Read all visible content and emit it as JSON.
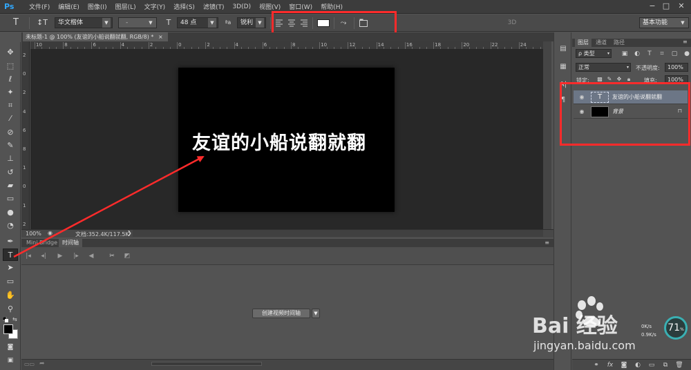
{
  "menubar": {
    "logo": "Ps",
    "items": [
      "文件(F)",
      "编辑(E)",
      "图像(I)",
      "图层(L)",
      "文字(Y)",
      "选择(S)",
      "滤镜(T)",
      "3D(D)",
      "视图(V)",
      "窗口(W)",
      "帮助(H)"
    ],
    "minimize": "−",
    "restore": "□",
    "close": "✕"
  },
  "options": {
    "tool_icon": "T",
    "orient_icon": "↕T",
    "font_family": "华文楷体",
    "font_style": "-",
    "size_icon": "T",
    "font_size": "48 点",
    "aa_icon": "ªa",
    "antialias": "锐利",
    "text_color": "#ffffff",
    "workspace": "基本功能",
    "threed_label": "3D"
  },
  "document": {
    "tab_title": "未标题-1 @ 100% (友谊的小船说翻就翻, RGB/8) *",
    "text": "友谊的小船说翻就翻",
    "canvas_color": "#000000"
  },
  "ruler": {
    "h": [
      "10",
      "8",
      "6",
      "4",
      "2",
      "0",
      "2",
      "4",
      "6",
      "8",
      "10",
      "12",
      "14",
      "16",
      "18",
      "20",
      "22",
      "24"
    ],
    "v": [
      "2",
      "0",
      "2",
      "4",
      "6",
      "8",
      "1",
      "0",
      "1",
      "2"
    ]
  },
  "status": {
    "zoom": "100%",
    "doc_size": "文档:352.4K/117.5K"
  },
  "timeline": {
    "tabs": [
      "Mini Bridge",
      "时间轴"
    ],
    "active_tab": 1,
    "create_button": "创建视频时间轴"
  },
  "layers_panel": {
    "tabs": [
      "图层",
      "通道",
      "路径"
    ],
    "filter_label": "ρ 类型",
    "blend_mode": "正常",
    "opacity_label": "不透明度:",
    "opacity_value": "100%",
    "lock_label": "锁定:",
    "fill_label": "填充:",
    "fill_value": "100%",
    "layers": [
      {
        "name": "友谊的小船说翻就翻",
        "type": "text",
        "selected": true
      },
      {
        "name": "背景",
        "type": "background",
        "selected": false,
        "locked": true
      }
    ]
  },
  "watermark": {
    "brand": "Bai 经验",
    "url": "jingyan.baidu.com",
    "netspeed_up": "0K/s",
    "netspeed_down": "0.9K/s",
    "gauge_value": "71",
    "gauge_unit": "%"
  },
  "colors": {
    "accent_red": "#ff2b2b",
    "ps_blue": "#31a8ff",
    "selected_layer": "#6c7686"
  }
}
